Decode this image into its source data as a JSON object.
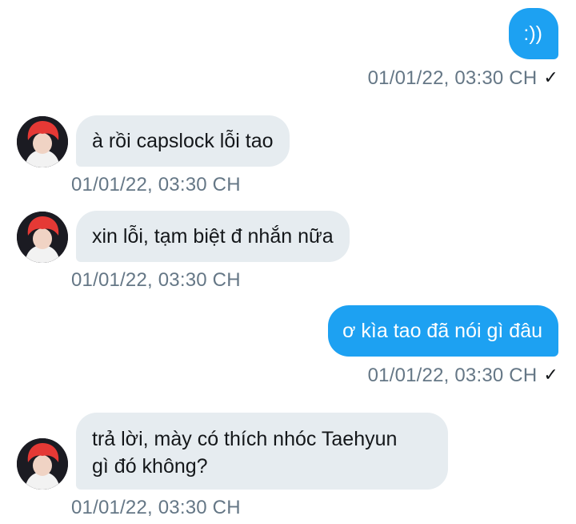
{
  "conversation": {
    "messages": [
      {
        "direction": "sent",
        "text": ":))",
        "timestamp": "01/01/22, 03:30 CH",
        "status": "✓"
      },
      {
        "direction": "received",
        "text": "à rồi capslock lỗi tao",
        "timestamp": "01/01/22, 03:30 CH"
      },
      {
        "direction": "received",
        "text": "xin lỗi, tạm biệt đ nhắn nữa",
        "timestamp": "01/01/22, 03:30 CH"
      },
      {
        "direction": "sent",
        "text": "ơ kìa tao đã nói gì đâu",
        "timestamp": "01/01/22, 03:30 CH",
        "status": "✓"
      },
      {
        "direction": "received",
        "text": "trả lời, mày có thích nhóc Taehyun\ngì đó không?",
        "timestamp": "01/01/22, 03:30 CH"
      }
    ]
  },
  "colors": {
    "sent_bubble": "#1da1f2",
    "received_bubble": "#e6ecf0",
    "timestamp_text": "#657786",
    "avatar_hair": "#e53935"
  },
  "icons": {
    "read_receipt": "check-icon",
    "contact_avatar": "avatar"
  }
}
